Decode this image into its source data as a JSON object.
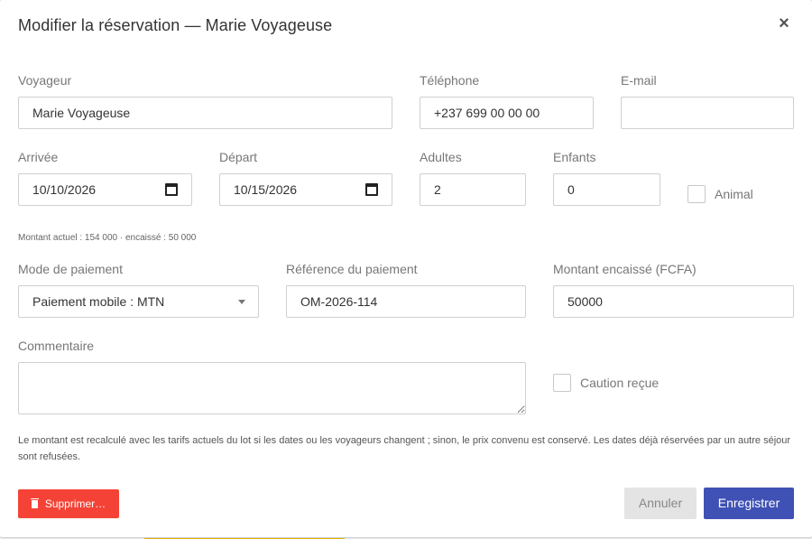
{
  "modal": {
    "title": "Modifier la réservation — Marie Voyageuse",
    "close_label": "×"
  },
  "fields": {
    "traveler": {
      "label": "Voyageur",
      "value": "Marie Voyageuse"
    },
    "phone": {
      "label": "Téléphone",
      "value": "+237 699 00 00 00"
    },
    "email": {
      "label": "E-mail",
      "value": ""
    },
    "arrival": {
      "label": "Arrivée",
      "value": "10/10/2026"
    },
    "departure": {
      "label": "Départ",
      "value": "10/15/2026"
    },
    "adults": {
      "label": "Adultes",
      "value": "2"
    },
    "children": {
      "label": "Enfants",
      "value": "0"
    },
    "pet": {
      "label": "Animal",
      "checked": false
    },
    "payment_mode": {
      "label": "Mode de paiement",
      "value": "Paiement mobile : MTN"
    },
    "payment_reference": {
      "label": "Référence du paiement",
      "value": "OM-2026-114"
    },
    "amount_collected": {
      "label": "Montant encaissé (FCFA)",
      "value": "50000"
    },
    "comment": {
      "label": "Commentaire",
      "value": ""
    },
    "deposit": {
      "label": "Caution reçue",
      "checked": false
    }
  },
  "amount_summary": "Montant actuel : 154 000 · encaissé : 50 000",
  "help_text": "Le montant est recalculé avec les tarifs actuels du lot si les dates ou les voyageurs changent ; sinon, le prix convenu est conservé. Les dates déjà réservées par un autre séjour sont refusées.",
  "buttons": {
    "delete": "Supprimer…",
    "cancel": "Annuler",
    "save": "Enregistrer"
  },
  "colors": {
    "primary": "#3f51b5",
    "danger": "#f44336"
  }
}
